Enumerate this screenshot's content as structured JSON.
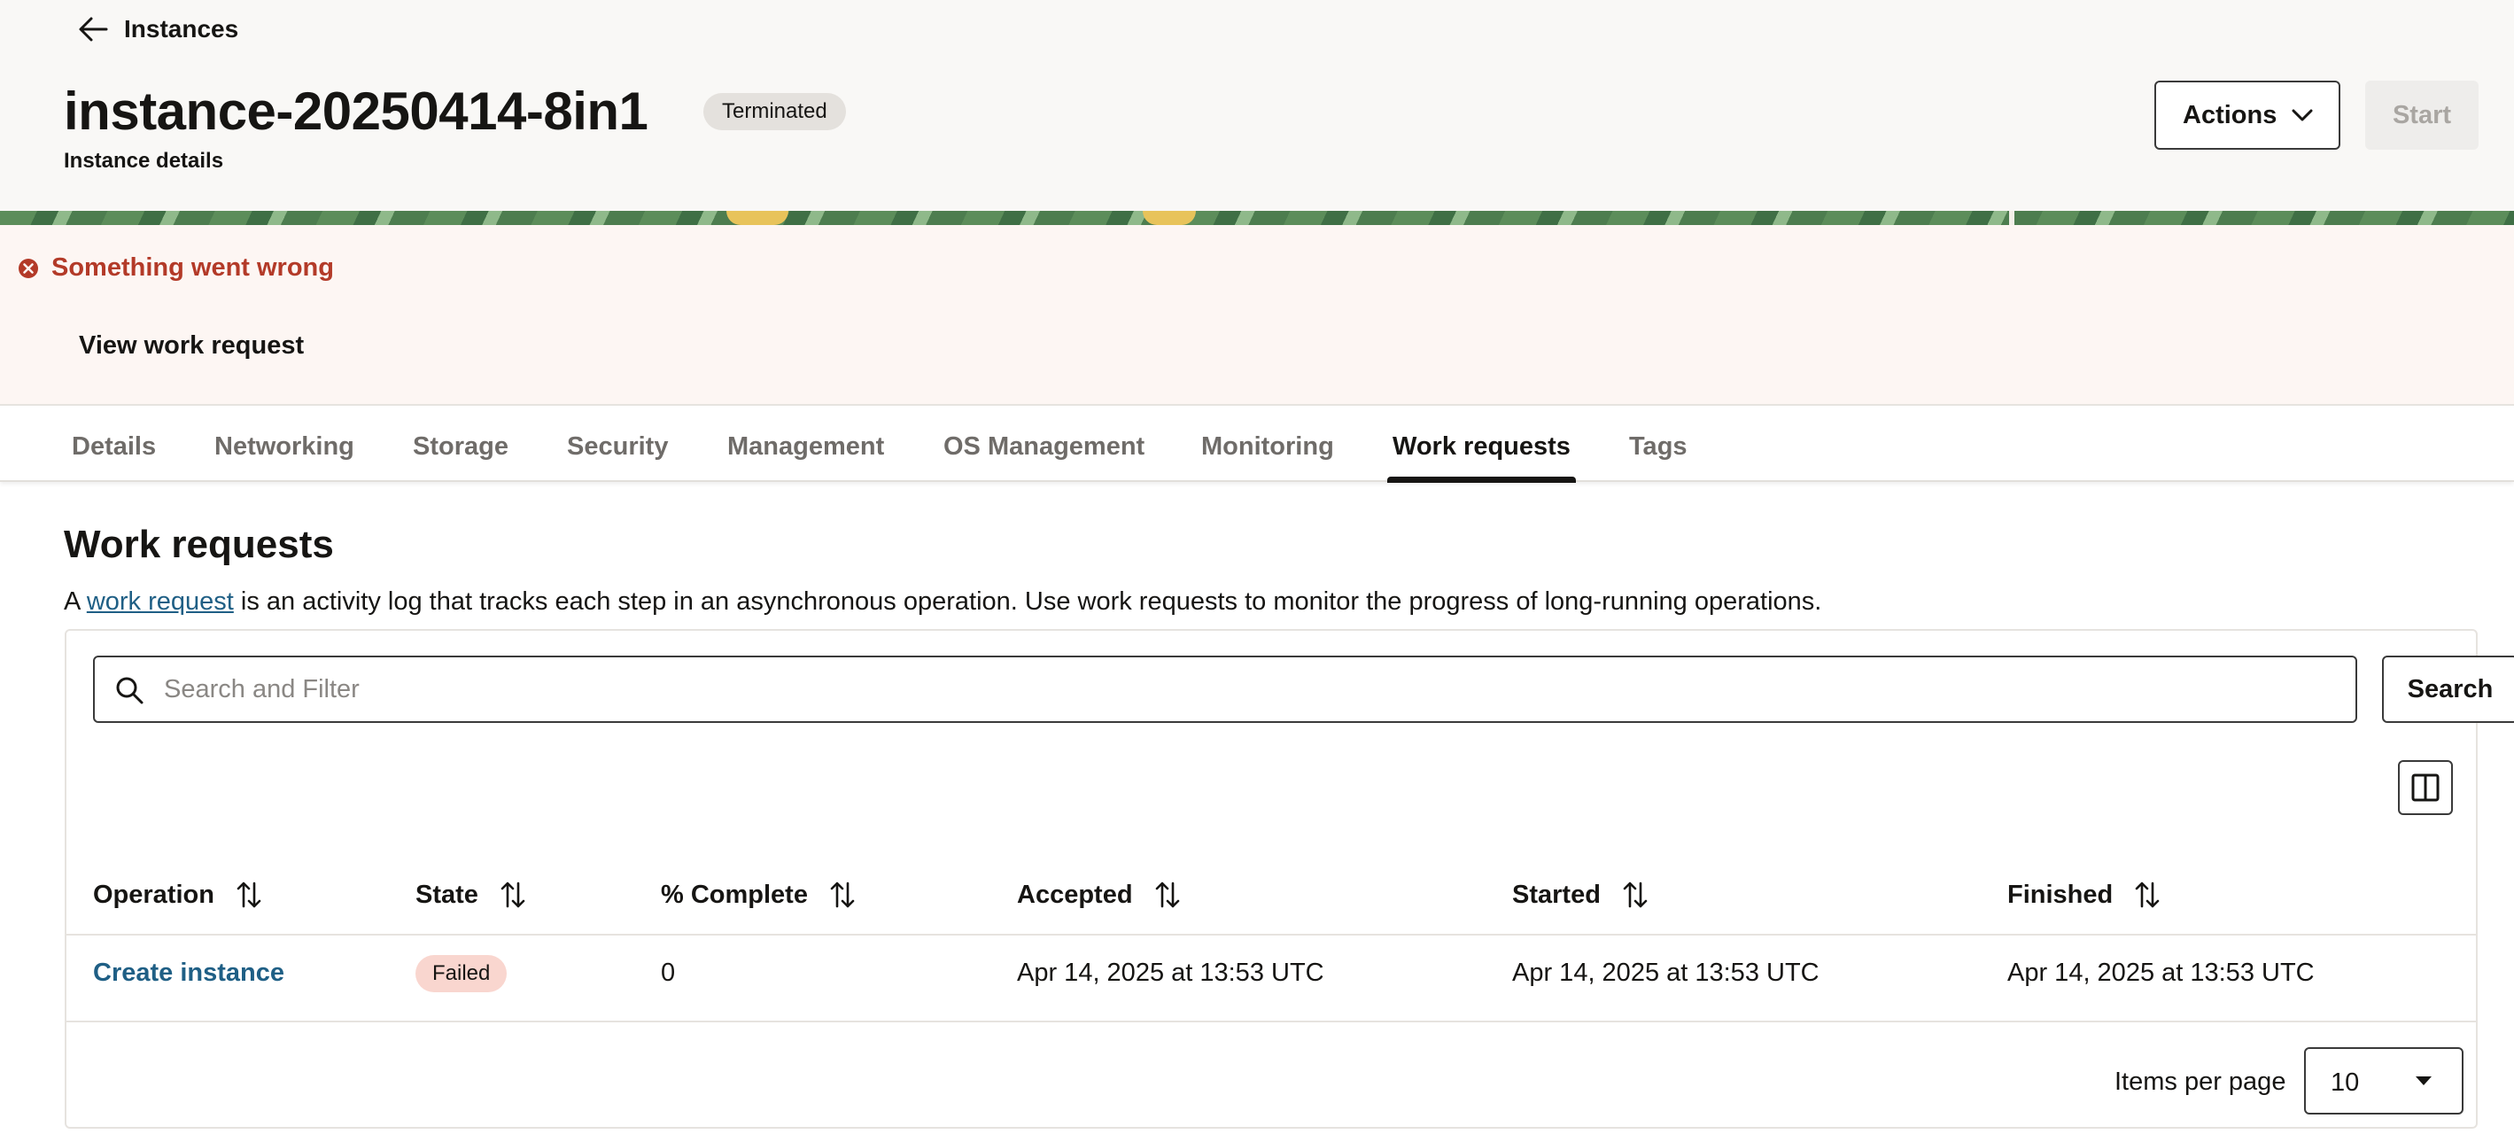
{
  "header": {
    "back_label": "Instances",
    "title": "instance-20250414-8in1",
    "status": "Terminated",
    "subtitle": "Instance details",
    "actions_label": "Actions",
    "start_label": "Start"
  },
  "error": {
    "title": "Something went wrong",
    "link_label": "View work request"
  },
  "tabs": [
    {
      "label": "Details"
    },
    {
      "label": "Networking"
    },
    {
      "label": "Storage"
    },
    {
      "label": "Security"
    },
    {
      "label": "Management"
    },
    {
      "label": "OS Management"
    },
    {
      "label": "Monitoring"
    },
    {
      "label": "Work requests",
      "active": true
    },
    {
      "label": "Tags"
    }
  ],
  "section": {
    "title": "Work requests",
    "desc_prefix": "A ",
    "desc_link": "work request",
    "desc_suffix": " is an activity log that tracks each step in an asynchronous operation. Use work requests to monitor the progress of long-running operations."
  },
  "search": {
    "placeholder": "Search and Filter",
    "button_label": "Search"
  },
  "table": {
    "columns": [
      "Operation",
      "State",
      "% Complete",
      "Accepted",
      "Started",
      "Finished"
    ],
    "rows": [
      {
        "operation": "Create instance",
        "state": "Failed",
        "percent_complete": "0",
        "accepted": "Apr 14, 2025 at 13:53 UTC",
        "started": "Apr 14, 2025 at 13:53 UTC",
        "finished": "Apr 14, 2025 at 13:53 UTC"
      }
    ]
  },
  "pagination": {
    "items_per_page_label": "Items per page",
    "items_per_page_value": "10"
  },
  "colors": {
    "accent_link": "#1f5f85",
    "error": "#b33a28",
    "failed_badge": "#f9d6cf",
    "terminated_badge": "#e4e1dd"
  }
}
